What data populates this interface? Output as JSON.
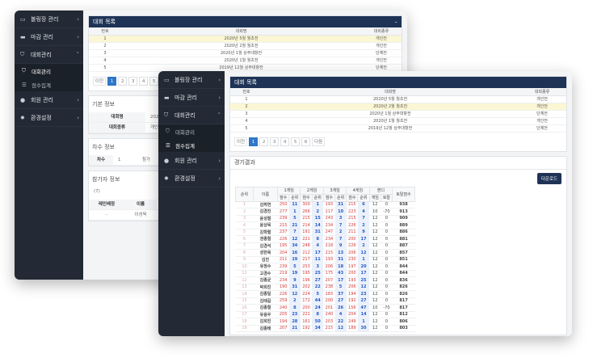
{
  "back": {
    "sidebar": {
      "items": [
        {
          "label": "볼링장 관리",
          "icon": "monitor-icon"
        },
        {
          "label": "마감 관리",
          "icon": "card-icon"
        },
        {
          "label": "대회관리",
          "icon": "shield-icon"
        }
      ],
      "sub_items": [
        {
          "label": "대회관리",
          "icon": "shield-icon",
          "active": true
        },
        {
          "label": "점수집계",
          "icon": "list-icon",
          "active": false
        }
      ],
      "items2": [
        {
          "label": "회원 관리",
          "icon": "user-icon"
        },
        {
          "label": "환경설정",
          "icon": "gear-icon"
        }
      ]
    },
    "list_title": "대회 목록",
    "list_head": {
      "no": "번호",
      "name": "대회명",
      "type": "대회종류"
    },
    "list_rows": [
      {
        "no": "1",
        "name": "2020년 5월 월초전",
        "type": "개인전",
        "hl": true
      },
      {
        "no": "2",
        "name": "2020년 2월 월초전",
        "type": "개인전",
        "hl": false
      },
      {
        "no": "3",
        "name": "2020년 1월 상주대항전",
        "type": "단체전",
        "hl": false
      },
      {
        "no": "4",
        "name": "2020년 1월 월초전",
        "type": "개인전",
        "hl": false
      },
      {
        "no": "5",
        "name": "2019년 12월 상주대항전",
        "type": "단체전",
        "hl": false
      }
    ],
    "pager": {
      "prev": "이전",
      "pages": [
        "1",
        "2",
        "3",
        "4",
        "5"
      ]
    },
    "basic_title": "기본 정보",
    "basic_rows": [
      {
        "k": "대회명",
        "v": "2020"
      },
      {
        "k": "대회종류",
        "v": "개인"
      }
    ],
    "order_title": "차수 정보",
    "order_row": {
      "k": "차수",
      "v": "1",
      "extra": "참가"
    },
    "players_title": "참가자 정보",
    "players_count": "(7)",
    "players_head": [
      "레인배정",
      "이름"
    ],
    "players_row": [
      "-",
      "이성욱"
    ]
  },
  "front": {
    "sidebar": {
      "items": [
        {
          "label": "볼링장 관리",
          "icon": "monitor-icon"
        },
        {
          "label": "마감 관리",
          "icon": "card-icon"
        },
        {
          "label": "대회관리",
          "icon": "shield-icon"
        }
      ],
      "sub_items": [
        {
          "label": "대회관리",
          "icon": "shield-icon",
          "active": false
        },
        {
          "label": "점수집계",
          "icon": "list-icon",
          "active": true
        }
      ],
      "items2": [
        {
          "label": "회원 관리",
          "icon": "user-icon"
        },
        {
          "label": "환경설정",
          "icon": "gear-icon"
        }
      ]
    },
    "list_title": "대회 목록",
    "list_head": {
      "no": "번호",
      "name": "대회명",
      "type": "대회종류"
    },
    "list_rows": [
      {
        "no": "1",
        "name": "2020년 5월 월초전",
        "type": "개인전",
        "hl": false
      },
      {
        "no": "2",
        "name": "2020년 2월 월초전",
        "type": "개인전",
        "hl": true
      },
      {
        "no": "3",
        "name": "2020년 1월 상주대항전",
        "type": "단체전",
        "hl": false
      },
      {
        "no": "4",
        "name": "2020년 1월 월초전",
        "type": "개인전",
        "hl": false
      },
      {
        "no": "5",
        "name": "2019년 12월 상주대항전",
        "type": "단체전",
        "hl": false
      }
    ],
    "pager": {
      "prev": "이전",
      "pages": [
        "1",
        "2",
        "3",
        "4",
        "5",
        "6"
      ],
      "next": "다음"
    },
    "results": {
      "title": "경기결과",
      "download": "다운로드",
      "head_rank": "순위",
      "head_name": "이름",
      "games": [
        "1게임",
        "2게임",
        "3게임",
        "4게임"
      ],
      "head_handi": "핸디",
      "head_total": "토탈점수",
      "sub_score": "점수",
      "sub_rank": "순위",
      "sub_game": "게임",
      "sub_total": "토탈",
      "rows": [
        [
          "1",
          "김하연",
          "250",
          "11",
          "300",
          "1",
          "193",
          "31",
          "215",
          "6",
          "12",
          "0",
          "938"
        ],
        [
          "2",
          "김경진",
          "277",
          "1",
          "266",
          "2",
          "217",
          "10",
          "223",
          "4",
          "10",
          "-70",
          "913"
        ],
        [
          "3",
          "윤성철",
          "239",
          "5",
          "215",
          "15",
          "243",
          "3",
          "215",
          "7",
          "12",
          "0",
          "909"
        ],
        [
          "4",
          "윤상목",
          "215",
          "21",
          "214",
          "14",
          "234",
          "7",
          "226",
          "2",
          "12",
          "0",
          "889"
        ],
        [
          "5",
          "김학렬",
          "237",
          "7",
          "191",
          "31",
          "247",
          "2",
          "211",
          "9",
          "12",
          "0",
          "886"
        ],
        [
          "6",
          "권종철",
          "226",
          "12",
          "221",
          "8",
          "234",
          "7",
          "200",
          "17",
          "12",
          "0",
          "881"
        ],
        [
          "7",
          "김경석",
          "195",
          "34",
          "248",
          "4",
          "218",
          "9",
          "226",
          "2",
          "12",
          "0",
          "887"
        ],
        [
          "8",
          "성한욱",
          "204",
          "16",
          "212",
          "17",
          "215",
          "13",
          "206",
          "12",
          "12",
          "0",
          "857"
        ],
        [
          "9",
          "김진",
          "211",
          "19",
          "217",
          "11",
          "193",
          "31",
          "230",
          "1",
          "12",
          "0",
          "851"
        ],
        [
          "10",
          "유정수",
          "239",
          "5",
          "253",
          "3",
          "206",
          "18",
          "197",
          "20",
          "12",
          "0",
          "844"
        ],
        [
          "11",
          "고경수",
          "219",
          "19",
          "195",
          "25",
          "175",
          "43",
          "200",
          "17",
          "12",
          "0",
          "844"
        ],
        [
          "12",
          "김종균",
          "234",
          "9",
          "196",
          "27",
          "207",
          "17",
          "193",
          "25",
          "12",
          "0",
          "836"
        ],
        [
          "13",
          "박희진",
          "190",
          "31",
          "202",
          "22",
          "238",
          "5",
          "206",
          "12",
          "12",
          "0",
          "826"
        ],
        [
          "14",
          "김종일",
          "226",
          "12",
          "224",
          "5",
          "183",
          "37",
          "194",
          "23",
          "12",
          "0",
          "826"
        ],
        [
          "15",
          "김태길",
          "259",
          "2",
          "172",
          "44",
          "200",
          "27",
          "192",
          "27",
          "12",
          "0",
          "817"
        ],
        [
          "16",
          "김종철",
          "240",
          "8",
          "200",
          "24",
          "201",
          "26",
          "156",
          "47",
          "10",
          "-70",
          "817"
        ],
        [
          "17",
          "유웅우",
          "205",
          "23",
          "221",
          "8",
          "240",
          "4",
          "204",
          "14",
          "12",
          "0",
          "812"
        ],
        [
          "18",
          "김희진",
          "194",
          "28",
          "161",
          "50",
          "203",
          "22",
          "249",
          "1",
          "12",
          "0",
          "806"
        ],
        [
          "19",
          "김종태",
          "207",
          "21",
          "192",
          "34",
          "215",
          "12",
          "189",
          "30",
          "12",
          "0",
          "803"
        ]
      ]
    }
  }
}
